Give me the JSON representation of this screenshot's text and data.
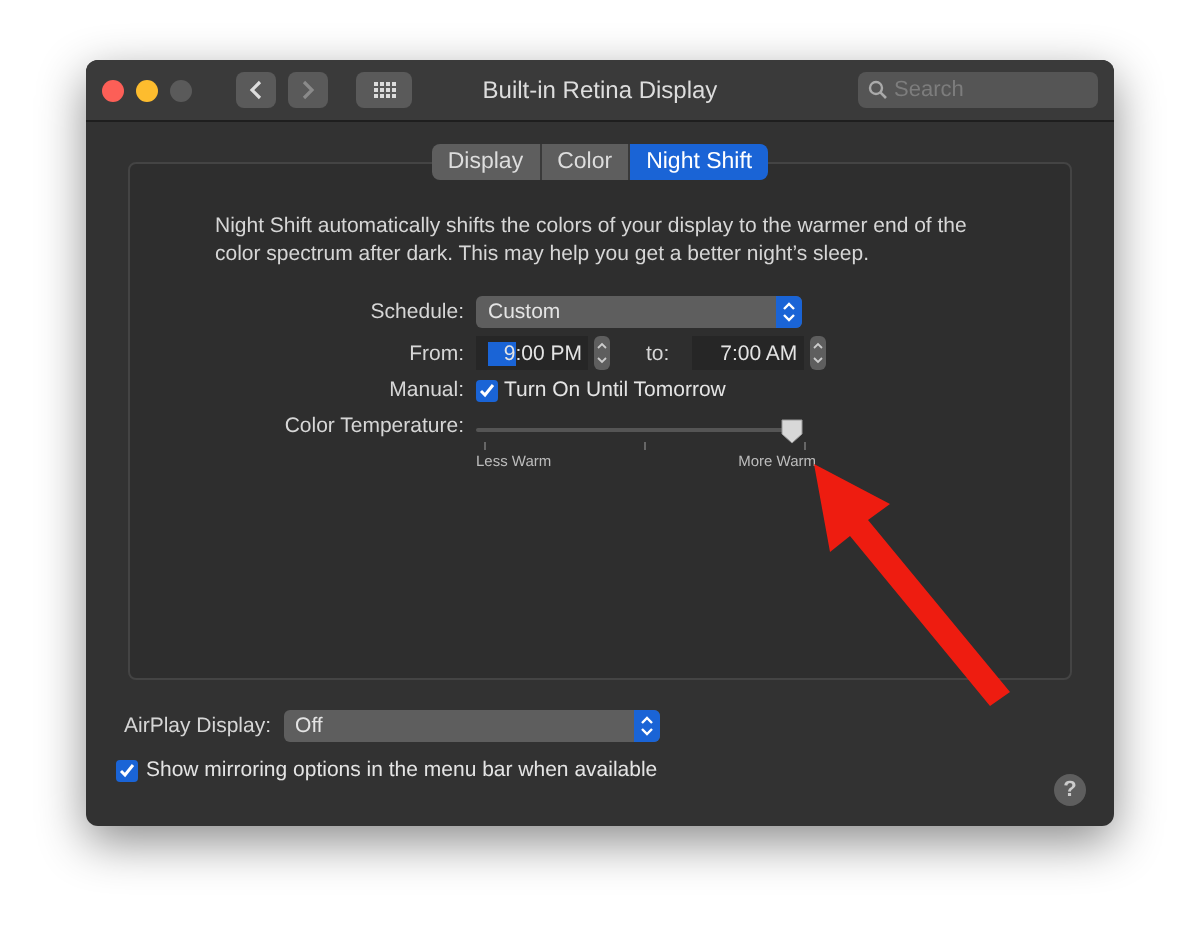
{
  "window": {
    "title": "Built-in Retina Display"
  },
  "search": {
    "placeholder": "Search"
  },
  "tabs": [
    {
      "label": "Display",
      "selected": false
    },
    {
      "label": "Color",
      "selected": false
    },
    {
      "label": "Night Shift",
      "selected": true
    }
  ],
  "description": "Night Shift automatically shifts the colors of your display to the warmer end of the color spectrum after dark. This may help you get a better night’s sleep.",
  "schedule": {
    "label": "Schedule:",
    "value": "Custom"
  },
  "from": {
    "label": "From:",
    "segments": [
      {
        "text": "9",
        "selected": true
      },
      {
        "text": ":00 PM",
        "selected": false
      }
    ]
  },
  "to": {
    "label": "to:",
    "value": "7:00 AM"
  },
  "manual": {
    "label": "Manual:",
    "checkbox_label": "Turn On Until Tomorrow",
    "checked": true
  },
  "temperature": {
    "label": "Color Temperature:",
    "level": 0.95,
    "min_label": "Less Warm",
    "max_label": "More Warm"
  },
  "airplay": {
    "label": "AirPlay Display:",
    "value": "Off"
  },
  "mirroring": {
    "label": "Show mirroring options in the menu bar when available",
    "checked": true
  },
  "help": "?"
}
